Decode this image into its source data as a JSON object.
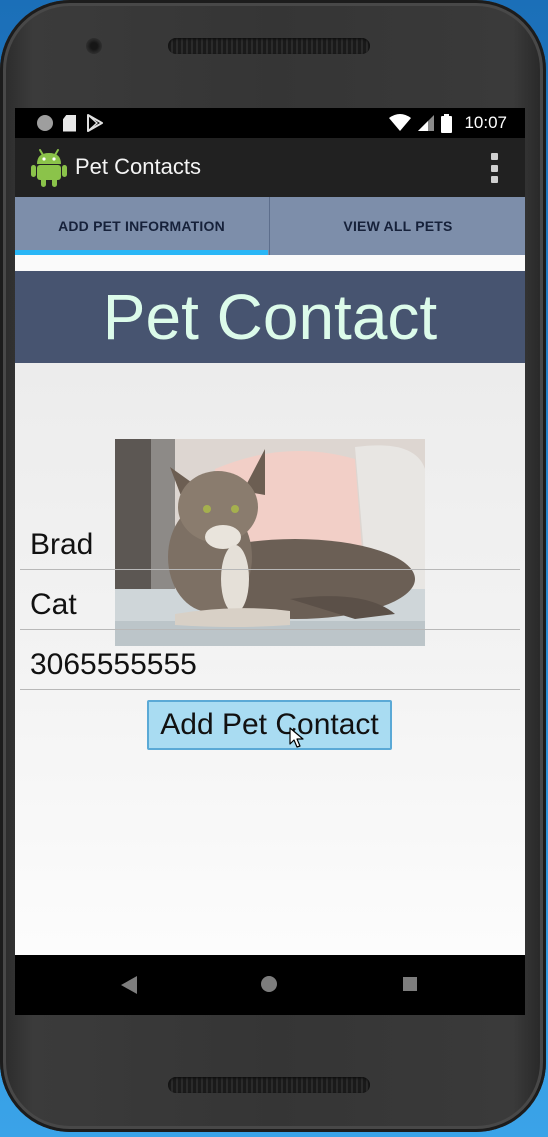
{
  "status_bar": {
    "time": "10:07",
    "icons": [
      "notification-dot-icon",
      "sd-card-icon",
      "play-store-icon",
      "wifi-icon",
      "signal-icon",
      "battery-icon"
    ]
  },
  "app_bar": {
    "title": "Pet Contacts",
    "logo": "android-robot-icon",
    "menu_icon": "overflow-menu-icon"
  },
  "tabs": [
    {
      "label": "ADD PET INFORMATION",
      "selected": true
    },
    {
      "label": "VIEW ALL PETS",
      "selected": false
    }
  ],
  "header": {
    "title": "Pet Contact"
  },
  "form": {
    "name_value": "Brad",
    "type_value": "Cat",
    "phone_value": "3065555555",
    "submit_label": "Add Pet Contact"
  },
  "nav": {
    "icons": [
      "back-icon",
      "home-icon",
      "recents-icon"
    ]
  },
  "colors": {
    "app_bar": "#212121",
    "tab_bar": "#7d8eaa",
    "tab_indicator": "#29b6f6",
    "header_banner": "#475470",
    "header_text": "#dcfbea",
    "button": "#a9dcf2",
    "button_border": "#5aa9d6"
  }
}
